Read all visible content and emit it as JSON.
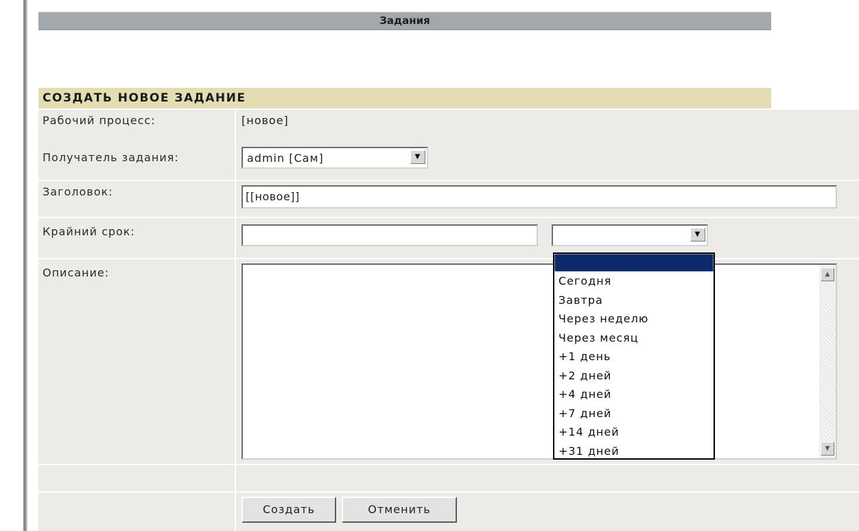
{
  "page": {
    "title": "Задания",
    "section_header": "СОЗДАТЬ НОВОЕ ЗАДАНИЕ"
  },
  "form": {
    "workflow": {
      "label": "Рабочий процесс:",
      "value": "[новое]"
    },
    "assignee": {
      "label": "Получатель задания:",
      "selected": "admin [Сам]"
    },
    "subject": {
      "label": "Заголовок:",
      "value": "[[новое]]"
    },
    "deadline": {
      "label": "Крайний срок:",
      "date_value": "",
      "preset_selected": ""
    },
    "description": {
      "label": "Описание:",
      "value": ""
    }
  },
  "deadline_options": [
    "",
    "Сегодня",
    "Завтра",
    "Через неделю",
    "Через месяц",
    "+1 день",
    "+2 дней",
    "+4 дней",
    "+7 дней",
    "+14 дней",
    "+31 дней"
  ],
  "buttons": {
    "create": "Создать",
    "cancel": "Отменить"
  },
  "icons": {
    "dropdown": "chevron-down-icon",
    "scroll_up": "arrow-up-icon",
    "scroll_down": "arrow-down-icon"
  }
}
